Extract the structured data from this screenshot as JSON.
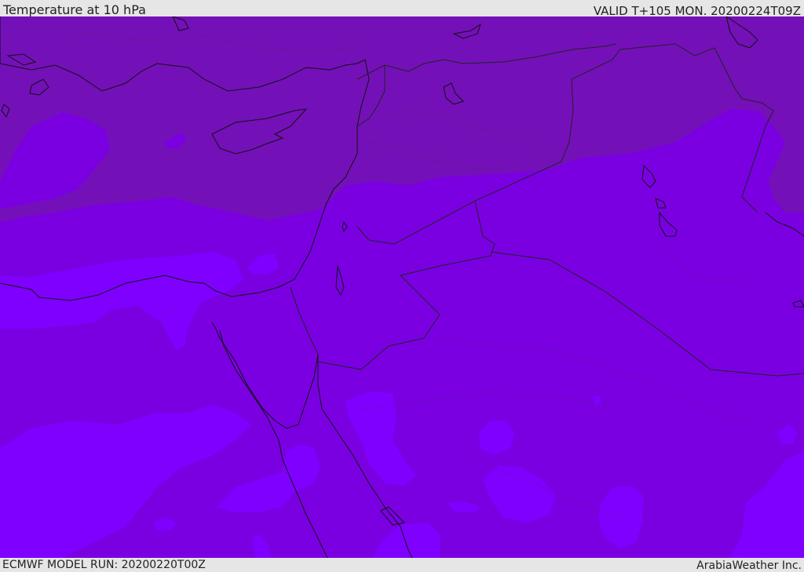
{
  "header": {
    "title": "Temperature at 10 hPa",
    "valid": "VALID T+105 MON. 20200224T09Z"
  },
  "footer": {
    "model_run": "ECMWF MODEL RUN: 20200220T00Z",
    "credit": "ArabiaWeather Inc."
  },
  "map": {
    "colors": {
      "band_dark": "#7410b8",
      "band_mid": "#7a00e2",
      "band_light": "#7f00ff",
      "coast": "#111111",
      "border": "#333333"
    }
  }
}
